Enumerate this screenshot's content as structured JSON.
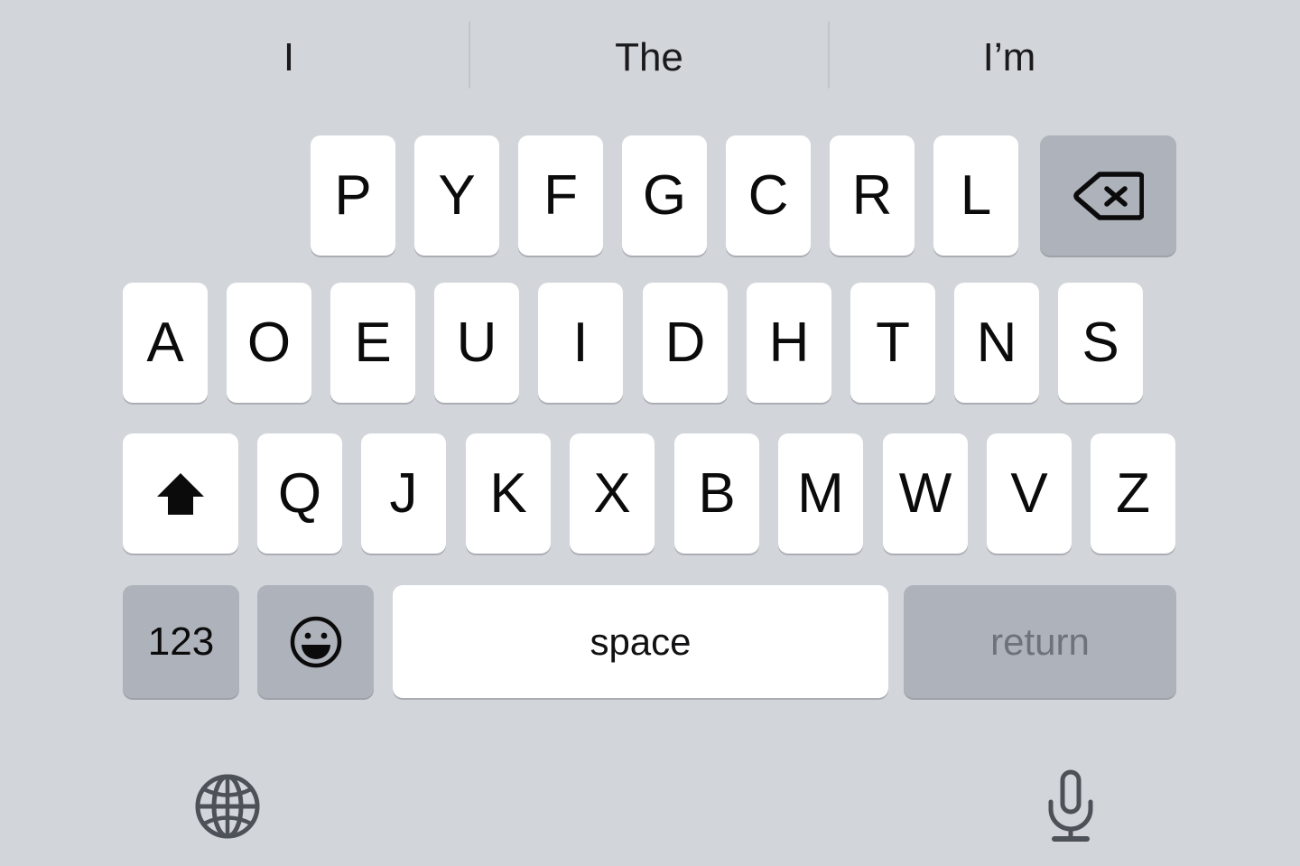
{
  "background_color": "#d2d5da",
  "key_color": "#ffffff",
  "special_key_color": "#aeb2ba",
  "return_text_color": "#6e727a",
  "suggestions": {
    "items": [
      {
        "label": "I"
      },
      {
        "label": "The"
      },
      {
        "label": "I’m"
      }
    ]
  },
  "keyboard": {
    "layout_name": "Dvorak",
    "rows": [
      {
        "name": "row-1",
        "keys": [
          {
            "name": "key-p",
            "label": "P",
            "type": "letter"
          },
          {
            "name": "key-y",
            "label": "Y",
            "type": "letter"
          },
          {
            "name": "key-f",
            "label": "F",
            "type": "letter"
          },
          {
            "name": "key-g",
            "label": "G",
            "type": "letter"
          },
          {
            "name": "key-c",
            "label": "C",
            "type": "letter"
          },
          {
            "name": "key-r",
            "label": "R",
            "type": "letter"
          },
          {
            "name": "key-l",
            "label": "L",
            "type": "letter"
          },
          {
            "name": "backspace-key",
            "label": "",
            "icon": "backspace-icon",
            "type": "special"
          }
        ]
      },
      {
        "name": "row-2",
        "keys": [
          {
            "name": "key-a",
            "label": "A",
            "type": "letter"
          },
          {
            "name": "key-o",
            "label": "O",
            "type": "letter"
          },
          {
            "name": "key-e",
            "label": "E",
            "type": "letter"
          },
          {
            "name": "key-u",
            "label": "U",
            "type": "letter"
          },
          {
            "name": "key-i",
            "label": "I",
            "type": "letter"
          },
          {
            "name": "key-d",
            "label": "D",
            "type": "letter"
          },
          {
            "name": "key-h",
            "label": "H",
            "type": "letter"
          },
          {
            "name": "key-t",
            "label": "T",
            "type": "letter"
          },
          {
            "name": "key-n",
            "label": "N",
            "type": "letter"
          },
          {
            "name": "key-s",
            "label": "S",
            "type": "letter"
          }
        ]
      },
      {
        "name": "row-3",
        "keys": [
          {
            "name": "shift-key",
            "label": "",
            "icon": "shift-arrow-icon",
            "type": "special"
          },
          {
            "name": "key-q",
            "label": "Q",
            "type": "letter"
          },
          {
            "name": "key-j",
            "label": "J",
            "type": "letter"
          },
          {
            "name": "key-k",
            "label": "K",
            "type": "letter"
          },
          {
            "name": "key-x",
            "label": "X",
            "type": "letter"
          },
          {
            "name": "key-b",
            "label": "B",
            "type": "letter"
          },
          {
            "name": "key-m",
            "label": "M",
            "type": "letter"
          },
          {
            "name": "key-w",
            "label": "W",
            "type": "letter"
          },
          {
            "name": "key-v",
            "label": "V",
            "type": "letter"
          },
          {
            "name": "key-z",
            "label": "Z",
            "type": "letter"
          }
        ]
      },
      {
        "name": "row-4",
        "keys": [
          {
            "name": "numbers-key",
            "label": "123",
            "type": "special"
          },
          {
            "name": "emoji-key",
            "label": "",
            "icon": "emoji-smiley-icon",
            "type": "special"
          },
          {
            "name": "space-key",
            "label": "space",
            "type": "space"
          },
          {
            "name": "return-key",
            "label": "return",
            "type": "return"
          }
        ]
      }
    ]
  },
  "accessory": {
    "globe": {
      "name": "globe-icon",
      "label": "globe-icon"
    },
    "mic": {
      "name": "microphone-icon",
      "label": "microphone-icon"
    }
  }
}
